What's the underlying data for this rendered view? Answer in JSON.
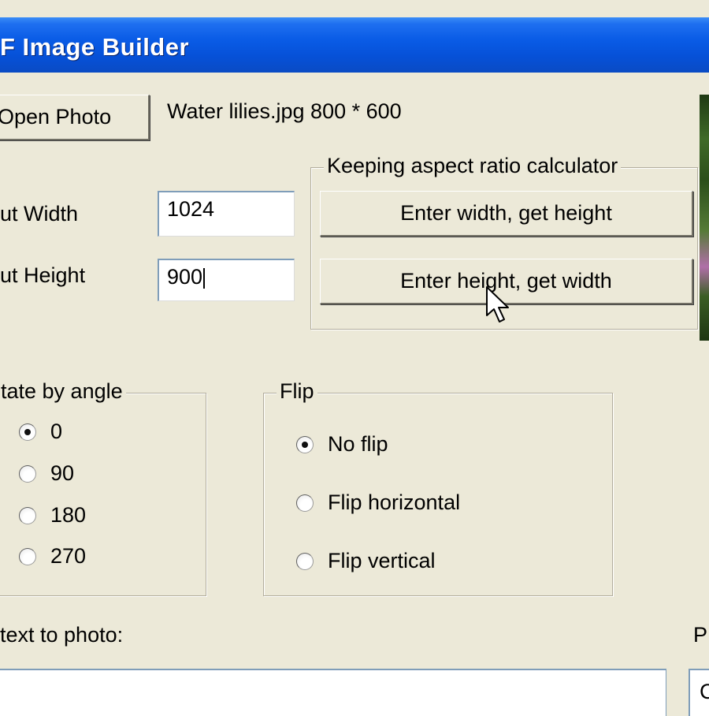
{
  "window": {
    "title": "F Image Builder"
  },
  "photo": {
    "open_button": "Open Photo",
    "info": "Water lilies.jpg 800 * 600"
  },
  "size": {
    "width_label": "ut Width",
    "width_value": "1024",
    "height_label": "ut Height",
    "height_value": "900"
  },
  "aspect_calc": {
    "legend": "Keeping aspect ratio calculator",
    "width_to_height_button": "Enter width, get height",
    "height_to_width_button": "Enter height, get width"
  },
  "rotate": {
    "legend": "tate by angle",
    "selected": "0",
    "options": [
      {
        "label": "0",
        "checked": true
      },
      {
        "label": "90",
        "checked": false
      },
      {
        "label": "180",
        "checked": false
      },
      {
        "label": "270",
        "checked": false
      }
    ]
  },
  "flip": {
    "legend": "Flip",
    "options": [
      {
        "label": "No flip",
        "checked": true
      },
      {
        "label": "Flip horizontal",
        "checked": false
      },
      {
        "label": "Flip vertical",
        "checked": false
      }
    ]
  },
  "text_to_photo": {
    "label": "text to photo:"
  },
  "right_panel": {
    "label": "P",
    "box_value": "C"
  },
  "icons": {
    "cursor": "arrow-cursor-icon",
    "radio": "radio-button-icon"
  }
}
